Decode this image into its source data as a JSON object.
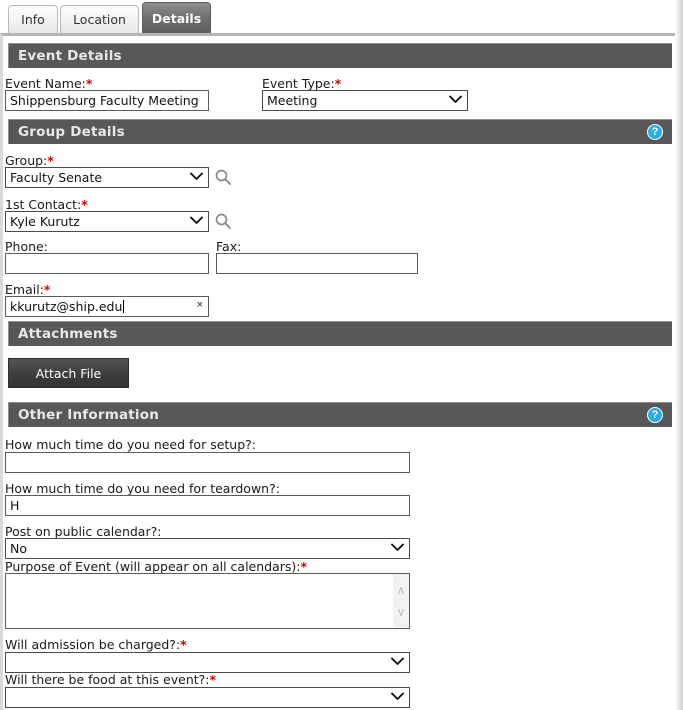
{
  "tabs": [
    {
      "id": "info",
      "label": "Info",
      "active": false
    },
    {
      "id": "location",
      "label": "Location",
      "active": false
    },
    {
      "id": "details",
      "label": "Details",
      "active": true
    }
  ],
  "sections": {
    "event_details": {
      "title": "Event Details",
      "help": false,
      "help_icon": "question-mark-icon"
    },
    "group_details": {
      "title": "Group Details",
      "help": true,
      "help_icon": "question-mark-icon",
      "help_glyph": "?"
    },
    "attachments": {
      "title": "Attachments",
      "help": false
    },
    "other_info": {
      "title": "Other Information",
      "help": true,
      "help_glyph": "?"
    }
  },
  "fields": {
    "event_name": {
      "label": "Event Name:",
      "required": "*",
      "value": "Shippensburg Faculty Meeting",
      "placeholder": ""
    },
    "event_type": {
      "label": "Event Type:",
      "required": "*",
      "value": "Meeting",
      "chevron": "⌄"
    },
    "group": {
      "label": "Group:",
      "required": "*",
      "value": "Faculty Senate",
      "chevron": "⌄",
      "search_icon": "magnifier-icon"
    },
    "contact1": {
      "label": "1st Contact:",
      "required": "*",
      "value": "Kyle Kurutz",
      "chevron": "⌄",
      "search_icon": "magnifier-icon"
    },
    "phone": {
      "label": "Phone:",
      "required": "",
      "value": "",
      "placeholder": ""
    },
    "fax": {
      "label": "Fax:",
      "required": "",
      "value": "",
      "placeholder": ""
    },
    "email": {
      "label": "Email:",
      "required": "*",
      "value": "kkurutz@ship.edu",
      "clear_glyph": "×",
      "focused": true
    },
    "setup_time": {
      "label": "How much time do you need for setup?:",
      "required": "",
      "value": "",
      "placeholder": ""
    },
    "teardown_time": {
      "label": "How much time do you need for teardown?:",
      "required": "",
      "value": "H",
      "placeholder": ""
    },
    "public_calendar": {
      "label": "Post on public calendar?:",
      "required": "",
      "value": "No",
      "chevron": "⌄"
    },
    "purpose": {
      "label": "Purpose of Event (will appear on all calendars):",
      "required": "*",
      "value": "",
      "placeholder": ""
    },
    "admission_charged": {
      "label": "Will admission be charged?:",
      "required": "*",
      "value": "",
      "chevron": "⌄"
    },
    "food_at_event": {
      "label": "Will there be food at this event?:",
      "required": "*",
      "value": "",
      "chevron": "⌄"
    }
  },
  "buttons": {
    "attach_file": "Attach File"
  },
  "scroll": {
    "up_glyph": "∧",
    "down_glyph": "∨"
  },
  "colors": {
    "section_bar": "#585858",
    "active_tab": "#6f6f6f",
    "required_asterisk": "#d00000",
    "help_blue": "#29ade4",
    "button_dark": "#3d3d3d"
  }
}
